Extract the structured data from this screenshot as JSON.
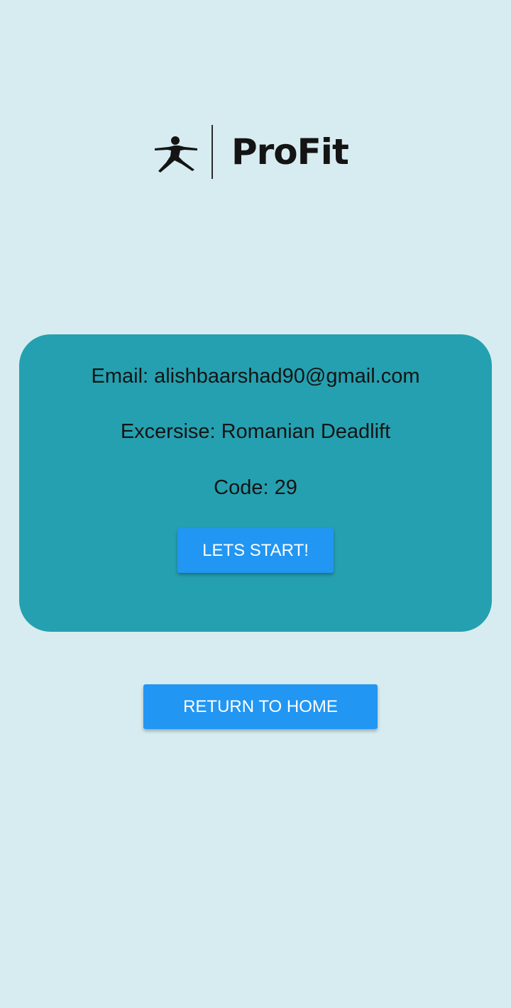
{
  "app": {
    "name": "ProFit",
    "logo_icon": "yoga-warrior-pose-icon",
    "background_color": "#d7ecf0",
    "card_color": "#25a0b0",
    "button_color": "#2196f3"
  },
  "session": {
    "email_label": "Email:",
    "email_value": "alishbaarshad90@gmail.com",
    "exercise_label": "Excersise:",
    "exercise_value": "Romanian Deadlift",
    "code_label": "Code:",
    "code_value": "29"
  },
  "actions": {
    "start_label": "LETS START!",
    "home_label": "RETURN TO HOME"
  }
}
